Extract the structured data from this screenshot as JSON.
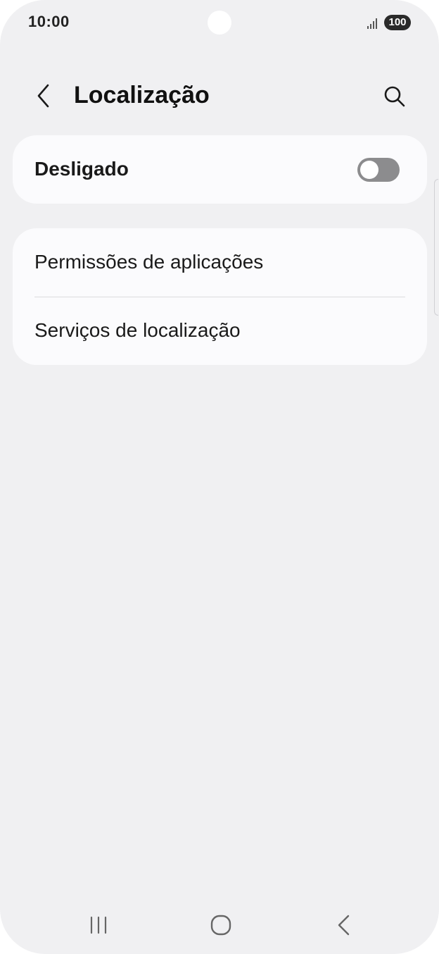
{
  "status_bar": {
    "time": "10:00",
    "battery": "100",
    "signal_icon": "signal-bars-icon"
  },
  "app_bar": {
    "title": "Localização",
    "back_icon": "chevron-left-icon",
    "search_icon": "search-icon"
  },
  "location_toggle": {
    "label": "Desligado",
    "state": "off"
  },
  "menu": {
    "items": [
      {
        "label": "Permissões de aplicações"
      },
      {
        "label": "Serviços de localização"
      }
    ]
  },
  "nav_bar": {
    "recents_icon": "recents-icon",
    "home_icon": "home-icon",
    "back_icon": "back-icon"
  },
  "colors": {
    "background": "#f0f0f2",
    "card": "#fbfbfd",
    "switch_off": "#8c8c8e"
  }
}
